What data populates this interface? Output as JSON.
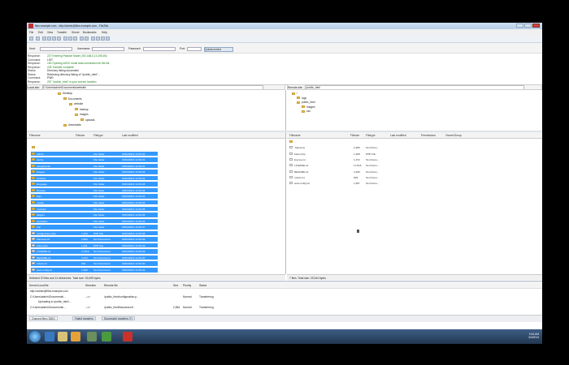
{
  "window": {
    "title": "files.example.com - sftp://admin@files.example.com - FileZilla"
  },
  "menu": [
    "File",
    "Edit",
    "View",
    "Transfer",
    "Server",
    "Bookmarks",
    "Help"
  ],
  "quickconnect": {
    "host_label": "Host:",
    "user_label": "Username:",
    "pass_label": "Password:",
    "port_label": "Port:",
    "button": "Quickconnect"
  },
  "log": [
    {
      "type": "Response:",
      "msg": "227 Entering Passive Mode (192,168,0,10,195,80)"
    },
    {
      "type": "Command:",
      "msg": "LIST",
      "black": true
    },
    {
      "type": "Response:",
      "msg": "150 Opening ASCII mode data connection for file list"
    },
    {
      "type": "Response:",
      "msg": "226 Transfer complete"
    },
    {
      "type": "Status:",
      "msg": "Directory listing successful",
      "black": true
    },
    {
      "type": "Status:",
      "msg": "Retrieving directory listing of \"/public_html\"...",
      "black": true
    },
    {
      "type": "Command:",
      "msg": "PWD",
      "black": true
    },
    {
      "type": "Response:",
      "msg": "257 \"/public_html\" is your current location"
    }
  ],
  "local_path": {
    "label": "Local site:",
    "value": "C:\\Users\\admin\\Documents\\website\\"
  },
  "remote_path": {
    "label": "Remote site:",
    "value": "/public_html"
  },
  "local_tree": [
    {
      "label": "Desktop",
      "indent": 0
    },
    {
      "label": "Documents",
      "indent": 1
    },
    {
      "label": "website",
      "indent": 2
    },
    {
      "label": "backup",
      "indent": 3
    },
    {
      "label": "images",
      "indent": 3
    },
    {
      "label": "uploads",
      "indent": 4
    },
    {
      "label": "downloads",
      "indent": 1
    }
  ],
  "remote_tree": [
    {
      "label": "/",
      "indent": 0
    },
    {
      "label": "logs",
      "indent": 1
    },
    {
      "label": "public_html",
      "indent": 1
    },
    {
      "label": "images",
      "indent": 2
    },
    {
      "label": "css",
      "indent": 2
    }
  ],
  "local_columns": [
    "Filename",
    "Filesize",
    "Filetype",
    "Last modified"
  ],
  "remote_columns": [
    "Filename",
    "Filesize",
    "Filetype",
    "Last modified",
    "Permissions",
    "Owner/Group"
  ],
  "local_files": [
    {
      "name": "..",
      "size": "",
      "type": "",
      "date": "",
      "selected": false
    },
    {
      "name": "admin",
      "size": "",
      "type": "File folder",
      "date": "03/04/2014 12:49:20"
    },
    {
      "name": "cache",
      "size": "",
      "type": "File folder",
      "date": "03/04/2014 12:49:21"
    },
    {
      "name": "components",
      "size": "",
      "type": "File folder",
      "date": "03/04/2014 12:49:21"
    },
    {
      "name": "images",
      "size": "",
      "type": "File folder",
      "date": "03/04/2014 12:49:22"
    },
    {
      "name": "includes",
      "size": "",
      "type": "File folder",
      "date": "03/04/2014 12:49:22"
    },
    {
      "name": "language",
      "size": "",
      "type": "File folder",
      "date": "03/04/2014 12:49:23"
    },
    {
      "name": "libraries",
      "size": "",
      "type": "File folder",
      "date": "03/04/2014 12:49:24"
    },
    {
      "name": "logs",
      "size": "",
      "type": "File folder",
      "date": "03/04/2014 12:49:24"
    },
    {
      "name": "media",
      "size": "",
      "type": "File folder",
      "date": "03/04/2014 12:49:25"
    },
    {
      "name": "modules",
      "size": "",
      "type": "File folder",
      "date": "03/04/2014 12:49:25"
    },
    {
      "name": "plugins",
      "size": "",
      "type": "File folder",
      "date": "03/04/2014 12:49:26"
    },
    {
      "name": "templates",
      "size": "",
      "type": "File folder",
      "date": "03/04/2014 12:49:26"
    },
    {
      "name": "tmp",
      "size": "",
      "type": "File folder",
      "date": "03/04/2014 12:49:27"
    },
    {
      "name": "configuration.php",
      "size": "1,919",
      "type": "PHP File",
      "date": "03/04/2014 12:49:28"
    },
    {
      "name": "htaccess.txt",
      "size": "2,864",
      "type": "Text Document",
      "date": "03/04/2014 12:49:28"
    },
    {
      "name": "index.php",
      "size": "1,211",
      "type": "PHP File",
      "date": "03/04/2014 12:49:29"
    },
    {
      "name": "LICENSE.txt",
      "size": "17,816",
      "type": "Text Document",
      "date": "03/04/2014 12:49:29"
    },
    {
      "name": "README.txt",
      "size": "4,213",
      "type": "Text Document",
      "date": "03/04/2014 12:49:30"
    },
    {
      "name": "robots.txt",
      "size": "829",
      "type": "Text Document",
      "date": "03/04/2014 12:49:30"
    },
    {
      "name": "web.config.txt",
      "size": "1,690",
      "type": "Text Document",
      "date": "03/04/2014 12:49:31"
    }
  ],
  "remote_files": [
    {
      "name": "..",
      "size": "",
      "type": ""
    },
    {
      "name": ".htaccess",
      "size": "2,286",
      "type": "Text Docu..."
    },
    {
      "name": "index.php",
      "size": "1,208",
      "type": "PHP File"
    },
    {
      "name": "license.txt",
      "size": "1,372",
      "type": "Text Docu..."
    },
    {
      "name": "LICENSE.txt",
      "size": "17,816",
      "type": "Text Docu..."
    },
    {
      "name": "README.txt",
      "size": "4,206",
      "type": "Text Docu..."
    },
    {
      "name": "robots.txt",
      "size": "829",
      "type": "Text Docu..."
    },
    {
      "name": "web.config.txt",
      "size": "1,657",
      "type": "Text Docu..."
    }
  ],
  "local_status": "Selected 20 files and 14 directories. Total size: 33,699 bytes",
  "remote_status": "7 files. Total size: 29,344 bytes",
  "queue_columns": [
    "Server/Local file",
    "Direction",
    "Remote file",
    "Size",
    "Priority",
    "Status"
  ],
  "queue_rows": [
    {
      "server": "sftp://admin@files.example.com",
      "dir": "",
      "remote": "",
      "size": "",
      "priority": "",
      "status": ""
    },
    {
      "server": "C:\\Users\\admin\\Documents\\...",
      "dir": "-->>",
      "remote": "/public_html/configuration.p...",
      "size": "",
      "priority": "Normal",
      "status": "Transferring"
    },
    {
      "server": "Uploading to /public_html/...",
      "dir": "",
      "remote": "",
      "size": "",
      "priority": "",
      "status": ""
    },
    {
      "server": "C:\\Users\\admin\\Documents\\...",
      "dir": "-->>",
      "remote": "/public_html/htaccess.txt",
      "size": "2,864",
      "priority": "Normal",
      "status": "Transferring"
    }
  ],
  "queue_tabs": [
    "Queued files (1861)",
    "Failed transfers",
    "Successful transfers (7)"
  ],
  "clock": {
    "time": "9:44 AM",
    "date": "3/4/2014"
  },
  "colors": {
    "selection": "#3399ff",
    "log_green": "#1a7f1a"
  }
}
